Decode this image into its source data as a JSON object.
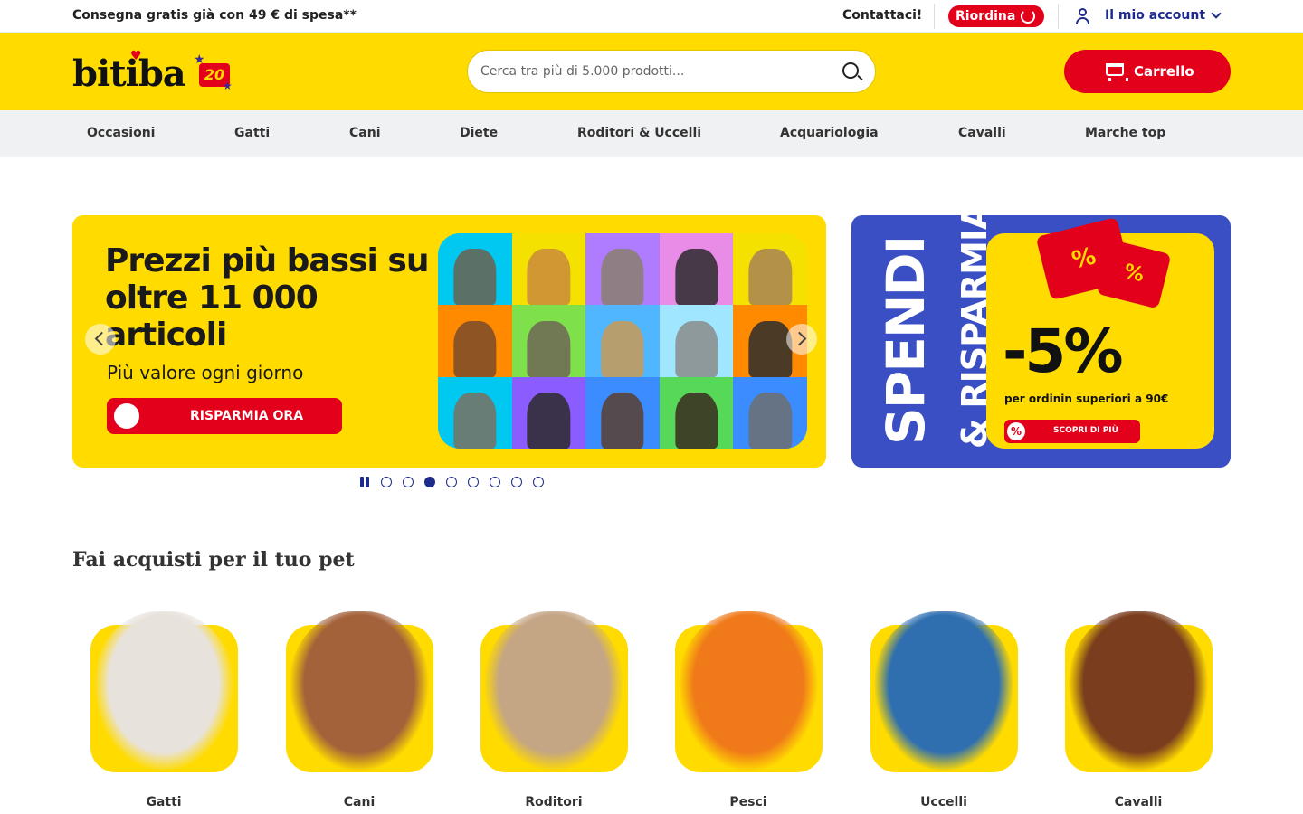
{
  "topbar": {
    "promo": "Consegna gratis già con 49 € di spesa**",
    "contact": "Contattaci!",
    "reorder": "Riordina",
    "account": "Il mio account"
  },
  "header": {
    "logo_text": "bitiba",
    "logo_badge": "20",
    "search_placeholder": "Cerca tra più di 5.000 prodotti...",
    "cart": "Carrello"
  },
  "nav": {
    "items": [
      "Occasioni",
      "Gatti",
      "Cani",
      "Diete",
      "Roditori & Uccelli",
      "Acquariologia",
      "Cavalli",
      "Marche top"
    ]
  },
  "hero": {
    "title": "Prezzi più bassi su oltre 11 000 articoli",
    "subtitle": "Più valore ogni giorno",
    "cta": "RISPARMIA ORA",
    "grid_colors": [
      "#00c8f0",
      "#f5e100",
      "#b07cff",
      "#e88ce8",
      "#f5e100",
      "#ff8a00",
      "#7ee04a",
      "#4fb6ff",
      "#a0e6ff",
      "#ff8a00",
      "#00c8f0",
      "#8b5cff",
      "#3b8cff",
      "#58d858",
      "#3b8cff"
    ],
    "pet_colors": [
      "#6b6150",
      "#c98a3c",
      "#8a7f6e",
      "#2a2a2a",
      "#a88356",
      "#7a4a2a",
      "#6e6656",
      "#c89a55",
      "#8b8b8b",
      "#2b2b2b",
      "#7a7060",
      "#2a2a2a",
      "#5a4030",
      "#3a2a20",
      "#6e6e6e"
    ],
    "slides": 8,
    "active_slide": 3
  },
  "side_promo": {
    "line1": "SPENDI",
    "line2": "& RISPARMIA",
    "tag1": "%",
    "tag2": "%",
    "discount": "-5%",
    "description": "per ordinin superiori a 90€",
    "button": "SCOPRI DI PIÙ",
    "button_icon": "%"
  },
  "section": {
    "title": "Fai acquisti per il tuo pet",
    "pets": [
      {
        "label": "Gatti",
        "icon": "cat-icon",
        "color": "#e8e2dc"
      },
      {
        "label": "Cani",
        "icon": "dog-icon",
        "color": "#a4623a"
      },
      {
        "label": "Roditori",
        "icon": "rabbit-icon",
        "color": "#c4a584"
      },
      {
        "label": "Pesci",
        "icon": "fish-icon",
        "color": "#f07a1a"
      },
      {
        "label": "Uccelli",
        "icon": "parrot-icon",
        "color": "#2f6fb0"
      },
      {
        "label": "Cavalli",
        "icon": "horse-icon",
        "color": "#7a3e1e"
      }
    ]
  },
  "colors": {
    "brand_yellow": "#ffdb00",
    "brand_red": "#e3001b",
    "brand_blue": "#1e2b8c"
  }
}
